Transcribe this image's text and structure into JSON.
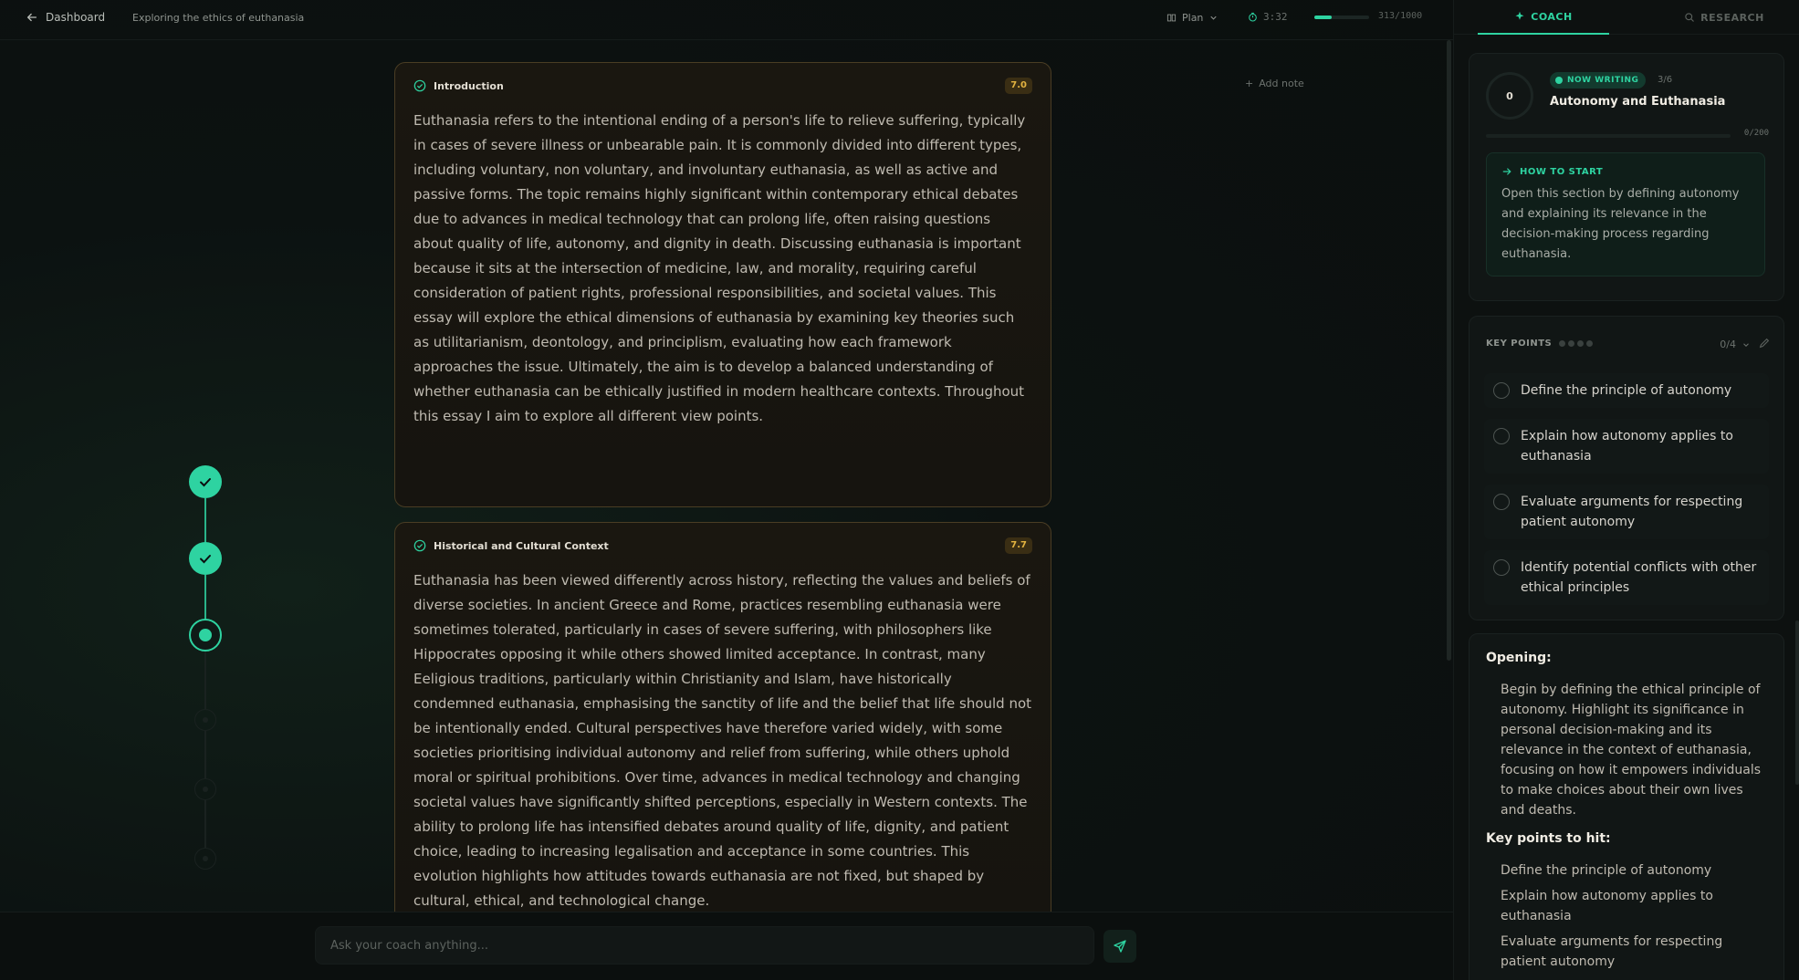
{
  "header": {
    "back_label": "Dashboard",
    "doc_title": "Exploring the ethics of euthanasia",
    "plan_label": "Plan",
    "timer": "3:32",
    "word_progress": 0.313,
    "word_count": "313/1000"
  },
  "add_note_label": "Add note",
  "timeline": {
    "steps": [
      "done",
      "done",
      "current",
      "future",
      "future",
      "future"
    ]
  },
  "sections": [
    {
      "title": "Introduction",
      "score": "7.0",
      "body": "Euthanasia refers to the intentional ending of a person's life to relieve suffering, typically in cases of severe illness or unbearable pain. It is commonly divided into different types, including voluntary, non voluntary, and involuntary euthanasia, as well as active and passive forms. The topic remains highly significant within contemporary ethical debates due to advances in medical technology that can prolong life, often raising questions about quality of life, autonomy, and dignity in death. Discussing euthanasia is important because it sits at the intersection of medicine, law, and morality, requiring careful consideration of patient rights, professional responsibilities, and societal values. This essay will explore the ethical dimensions of euthanasia by examining key theories such as utilitarianism, deontology, and principlism, evaluating how each framework approaches the issue. Ultimately, the aim is to develop a balanced understanding of whether euthanasia can be ethically justified in modern healthcare contexts. Throughout this essay I aim to explore all different view points."
    },
    {
      "title": "Historical and Cultural Context",
      "score": "7.7",
      "body": "Euthanasia has been viewed differently across history, reflecting the values and beliefs of diverse societies. In ancient Greece and Rome, practices resembling euthanasia were sometimes tolerated, particularly in cases of severe suffering, with philosophers like Hippocrates opposing it while others showed limited acceptance. In contrast, many Eeligious traditions, particularly within Christianity and Islam, have historically condemned euthanasia, emphasising the sanctity of life and the belief that life should not be intentionally ended. Cultural perspectives have therefore varied widely, with some societies prioritising individual autonomy and relief from suffering, while others uphold moral or spiritual prohibitions. Over time, advances in medical technology and changing societal values have significantly shifted perceptions, especially in Western contexts. The ability to prolong life has intensified debates around quality of life, dignity, and patient choice, leading to increasing legalisation and acceptance in some countries. This evolution highlights how attitudes towards euthanasia are not fixed, but shaped by cultural, ethical, and technological change."
    }
  ],
  "ask": {
    "placeholder": "Ask your coach anything..."
  },
  "sidebar": {
    "tabs": [
      "COACH",
      "RESEARCH"
    ],
    "now_writing": {
      "ring_value": "0",
      "badge": "NOW WRITING",
      "count": "3/6",
      "title": "Autonomy and Euthanasia",
      "section_words": "0/200",
      "section_progress": 0
    },
    "how_to_start": {
      "label": "HOW TO START",
      "text": "Open this section by defining autonomy and explaining its relevance in the decision-making process regarding euthanasia."
    },
    "key_points": {
      "label": "KEY POINTS",
      "count": "0/4",
      "items": [
        "Define the principle of autonomy",
        "Explain how autonomy applies to euthanasia",
        "Evaluate arguments for respecting patient autonomy",
        "Identify potential conflicts with other ethical principles"
      ]
    },
    "guide": {
      "opening_title": "Opening:",
      "opening_text": "Begin by defining the ethical principle of autonomy. Highlight its significance in personal decision-making and its relevance in the context of euthanasia, focusing on how it empowers individuals to make choices about their own lives and deaths.",
      "key_title": "Key points to hit:",
      "key_items": [
        "Define the principle of autonomy",
        "Explain how autonomy applies to euthanasia",
        "Evaluate arguments for respecting patient autonomy"
      ]
    }
  },
  "colors": {
    "accent": "#2ed3a1",
    "card_border": "#4a3d24",
    "score_text": "#e3b340"
  }
}
